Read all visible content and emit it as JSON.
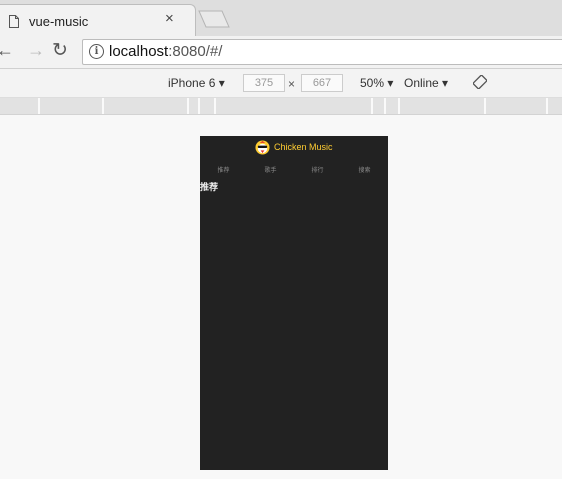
{
  "browser": {
    "tab_title": "vue-music",
    "tab_close": "×",
    "url_host": "localhost",
    "url_rest": ":8080/#/"
  },
  "devtools": {
    "device": "iPhone 6 ▾",
    "width": "375",
    "times": "×",
    "height": "667",
    "zoom": "50% ▾",
    "network": "Online ▾"
  },
  "app": {
    "title": "Chicken Music",
    "tabs": [
      "推荐",
      "歌手",
      "排行",
      "搜索"
    ],
    "page_text": "推荐",
    "colors": {
      "background": "#222222",
      "accent": "#ffcd32"
    }
  }
}
